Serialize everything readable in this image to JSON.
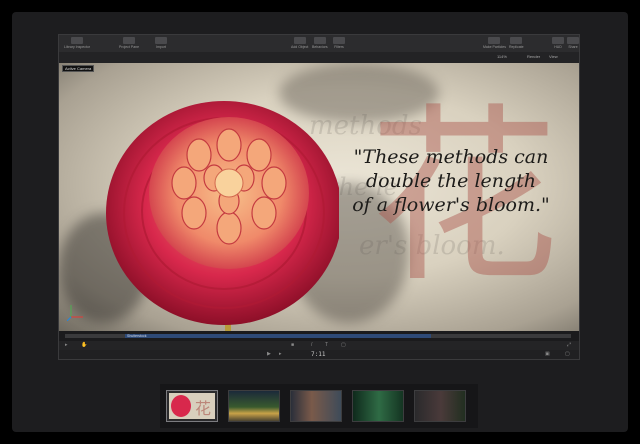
{
  "toolbar": {
    "left": [
      {
        "label": "Library Inspector",
        "icon": "library-icon"
      },
      {
        "label": "Project Pane",
        "icon": "project-pane-icon"
      },
      {
        "label": "Import",
        "icon": "import-icon"
      }
    ],
    "center": [
      {
        "label": "Add Object",
        "icon": "add-object-icon"
      },
      {
        "label": "Behaviors",
        "icon": "behaviors-icon"
      },
      {
        "label": "Filters",
        "icon": "filters-icon"
      }
    ],
    "right": [
      {
        "label": "Make Particles",
        "icon": "particles-icon"
      },
      {
        "label": "Replicate",
        "icon": "replicate-icon"
      },
      {
        "label": "HUD",
        "icon": "hud-icon"
      },
      {
        "label": "Share",
        "icon": "share-icon"
      }
    ]
  },
  "subbar": {
    "camera": "Active Camera",
    "zoom": "114%",
    "render": "Render",
    "view": "View"
  },
  "canvas": {
    "quote_lines": [
      "\"These methods can",
      "double the length",
      "of a flower's bloom.\""
    ],
    "kanji": "花"
  },
  "timeline": {
    "clip_label": "Shutterstock"
  },
  "transport": {
    "timecode": "7:11"
  },
  "colors": {
    "accent": "#2e4a77",
    "background": "#1d1d1f"
  }
}
